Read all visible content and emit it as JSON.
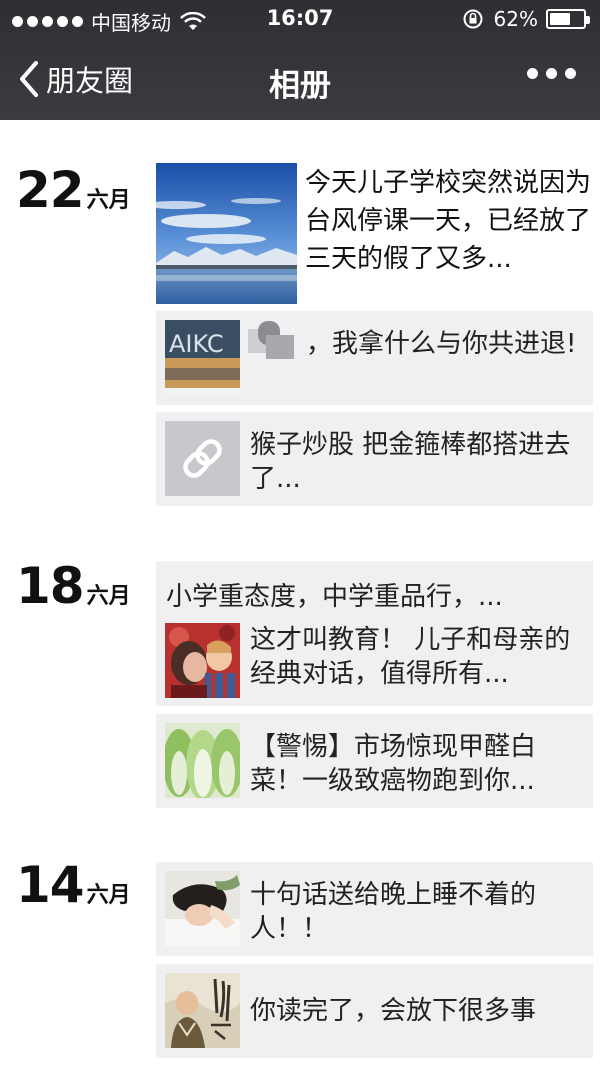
{
  "status": {
    "carrier": "中国移动",
    "time": "16:07",
    "battery": "62%",
    "battery_level": 0.62
  },
  "nav": {
    "back_label": "朋友圈",
    "title": "相册",
    "icons": [
      "chevron-left-icon",
      "more-dots-icon"
    ]
  },
  "sections": [
    {
      "day": "22",
      "month": "六月",
      "photo_post": {
        "text": "今天儿子学校突然说因为台风停课一天，已经放了三天的假了又多..."
      },
      "shares": [
        {
          "text": "，我拿什么与你共进退!"
        },
        {
          "text": "猴子炒股 把金箍棒都搭进去了..."
        }
      ]
    },
    {
      "day": "18",
      "month": "六月",
      "share_group": {
        "title": "小学重态度，中学重品行，...",
        "text": "这才叫教育！ 儿子和母亲的经典对话，值得所有..."
      },
      "shares": [
        {
          "text": "【警惕】市场惊现甲醛白菜！一级致癌物跑到你..."
        }
      ]
    },
    {
      "day": "14",
      "month": "六月",
      "shares": [
        {
          "text": "十句话送给晚上睡不着的人！！"
        },
        {
          "text": "你读完了，会放下很多事"
        }
      ]
    }
  ]
}
